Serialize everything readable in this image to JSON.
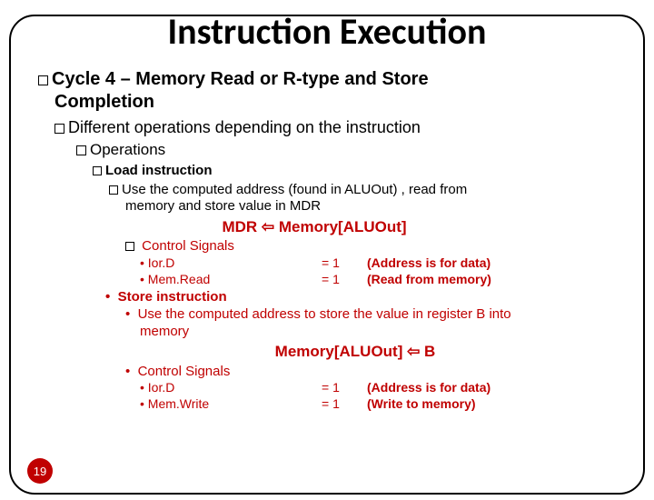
{
  "title": "Instruction Execution",
  "l1_a": "Cycle 4 – Memory Read or R-type and Store",
  "l1_b": "Completion",
  "l2": "Different operations depending on the instruction",
  "l3": "Operations",
  "load": {
    "header": "Load instruction",
    "desc1": "Use the computed address (found in ALUOut) , read  from",
    "desc2": "memory and store value in MDR",
    "formula": "MDR ⇦ Memory[ALUOut]",
    "ctrl": "Control Signals",
    "sig1": {
      "name": "Ior.D",
      "val": "= 1",
      "note": "(Address is for data)"
    },
    "sig2": {
      "name": "Mem.Read",
      "val": "= 1",
      "note": "(Read from memory)"
    }
  },
  "store": {
    "header": "Store instruction",
    "desc1": "Use the computed address to store the value in register B into",
    "desc2": "memory",
    "formula": "Memory[ALUOut] ⇦ B",
    "ctrl": "Control Signals",
    "sig1": {
      "name": "Ior.D",
      "val": "= 1",
      "note": "(Address is for data)"
    },
    "sig2": {
      "name": "Mem.Write",
      "val": "= 1",
      "note": "(Write to memory)"
    }
  },
  "page": "19"
}
